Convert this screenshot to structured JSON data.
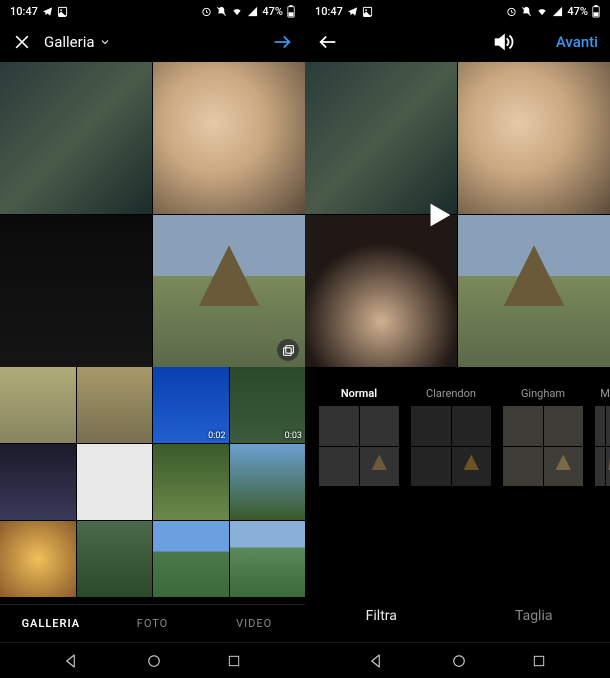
{
  "status": {
    "time": "10:47",
    "battery": "47%"
  },
  "left": {
    "title": "Galleria",
    "thumbs": {
      "durations": [
        "0:02",
        "0:03"
      ]
    },
    "tabs": [
      "GALLERIA",
      "FOTO",
      "VIDEO"
    ],
    "active_tab": 0
  },
  "right": {
    "next": "Avanti",
    "filters": [
      "Normal",
      "Clarendon",
      "Gingham",
      "M"
    ],
    "active_filter": 0,
    "edit_tabs": [
      "Filtra",
      "Taglia"
    ],
    "active_edit_tab": 0
  }
}
